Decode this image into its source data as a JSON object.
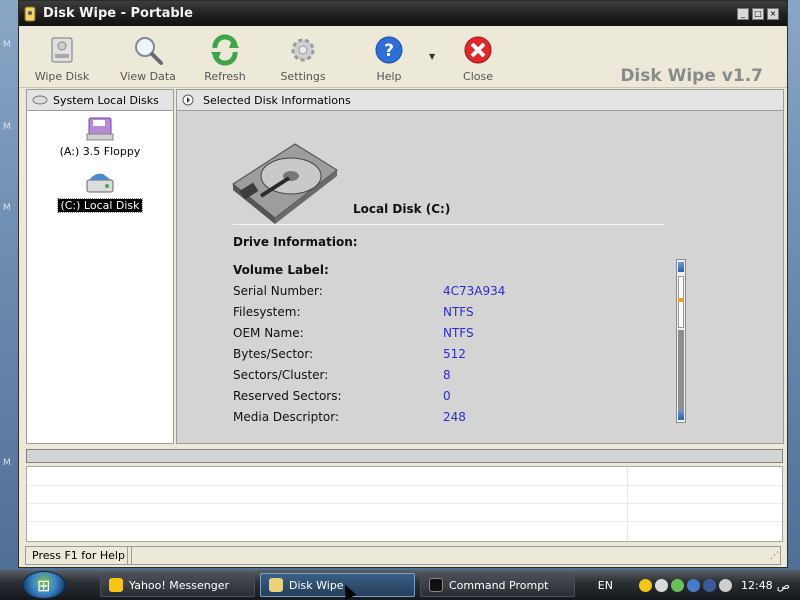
{
  "window": {
    "title": "Disk Wipe  - Portable",
    "controls": [
      "_",
      "□",
      "×"
    ]
  },
  "toolbar": {
    "buttons": [
      {
        "label": "Wipe Disk",
        "icon": "hard-disk-icon"
      },
      {
        "label": "View Data",
        "icon": "magnifier-icon"
      },
      {
        "label": "Refresh",
        "icon": "refresh-icon"
      },
      {
        "label": "Settings",
        "icon": "gear-icon"
      },
      {
        "label": "Help",
        "icon": "help-icon"
      },
      {
        "label": "Close",
        "icon": "close-icon"
      }
    ],
    "help_dropdown": "▼",
    "brand": "Disk Wipe v1.7"
  },
  "left_panel": {
    "header": "System Local Disks",
    "disks": [
      {
        "label": "(A:) 3.5 Floppy",
        "icon": "floppy-drive-icon",
        "selected": false
      },
      {
        "label": "(C:) Local Disk",
        "icon": "local-disk-icon",
        "selected": true
      }
    ]
  },
  "right_panel": {
    "header": "Selected Disk Informations",
    "disk_title": "Local Disk  (C:)",
    "drive_info_label": "Drive Information:",
    "volume_label": "Volume Label:",
    "rows": [
      {
        "key": "Serial Number:",
        "value": "4C73A934"
      },
      {
        "key": "Filesystem:",
        "value": "NTFS"
      },
      {
        "key": "OEM Name:",
        "value": "NTFS"
      },
      {
        "key": "Bytes/Sector:",
        "value": "512"
      },
      {
        "key": "Sectors/Cluster:",
        "value": "8"
      },
      {
        "key": "Reserved Sectors:",
        "value": "0"
      },
      {
        "key": "Media Descriptor:",
        "value": "248"
      }
    ]
  },
  "status": {
    "hint": "Press F1 for Help"
  },
  "taskbar": {
    "items": [
      {
        "label": "Yahoo! Messenger",
        "active": false
      },
      {
        "label": "Disk Wipe",
        "active": true
      },
      {
        "label": "Command Prompt",
        "active": false
      }
    ],
    "language": "EN",
    "clock": "12:48",
    "ampm": "ص"
  },
  "colors": {
    "value_text": "#2b2bd0",
    "title_bar": "#1e1e1e",
    "window_bg": "#ece9d8"
  }
}
